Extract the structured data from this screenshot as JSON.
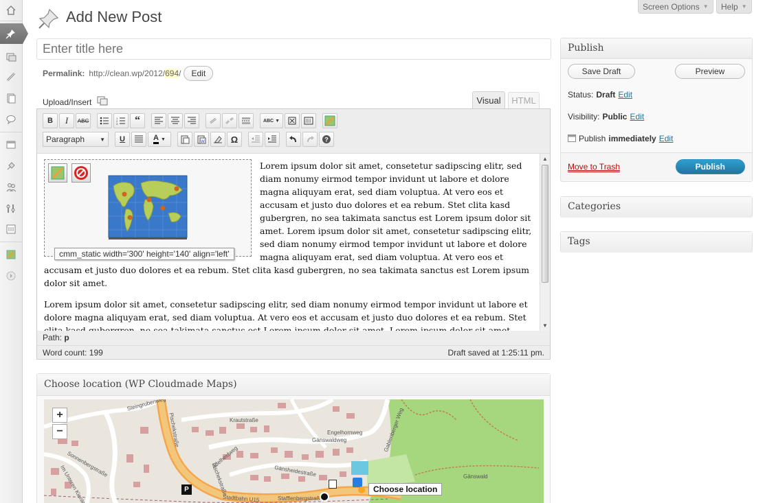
{
  "page": {
    "title": "Add New Post"
  },
  "top_tabs": {
    "screen_options": "Screen Options",
    "help": "Help"
  },
  "title_field": {
    "placeholder": "Enter title here",
    "value": ""
  },
  "permalink": {
    "label": "Permalink:",
    "base": "http://clean.wp/2012/",
    "slug": "694",
    "trail": "/",
    "edit_button": "Edit"
  },
  "editor": {
    "upload_insert": "Upload/Insert",
    "tabs": {
      "visual": "Visual",
      "html": "HTML"
    },
    "format_select": "Paragraph",
    "image_caption": "cmm_static width='300' height='140' align='left'",
    "paragraphs": [
      "Lorem ipsum dolor sit amet, consetetur sadipscing elitr, sed diam nonumy eirmod tempor invidunt ut labore et dolore magna aliquyam erat, sed diam voluptua. At vero eos et accusam et justo duo dolores et ea rebum. Stet clita kasd gubergren, no sea takimata sanctus est Lorem ipsum dolor sit amet. Lorem ipsum dolor sit amet, consetetur sadipscing elitr, sed diam nonumy eirmod tempor invidunt ut labore et dolore magna aliquyam erat, sed diam voluptua. At vero eos et accusam et justo duo dolores et ea rebum. Stet clita kasd gubergren, no sea takimata sanctus est Lorem ipsum dolor sit amet.",
      "Lorem ipsum dolor sit amet, consetetur sadipscing elitr, sed diam nonumy eirmod tempor invidunt ut labore et dolore magna aliquyam erat, sed diam voluptua. At vero eos et accusam et justo duo dolores et ea rebum. Stet clita kasd gubergren, no sea takimata sanctus est Lorem ipsum dolor sit amet. Lorem ipsum dolor sit amet, consetetur"
    ],
    "path_label": "Path:",
    "path_value": "p",
    "word_count": "Word count: 199",
    "draft_saved": "Draft saved at 1:25:11 pm."
  },
  "map_box": {
    "title": "Choose location (WP Cloudmade Maps)",
    "zoom_in": "+",
    "zoom_out": "−",
    "tooltip": "Choose location",
    "streets": [
      "Steingrubenweg",
      "Pischekstraße",
      "Krautstraße",
      "Gänswaldweg",
      "Engelhornweg",
      "Gablenberger Weg",
      "Adelheidweg",
      "Gänsheidestraße",
      "Sonnenbergstraße",
      "Im Unteren Kienle",
      "Stadtbahn U15",
      "Gänswald",
      "Stafflenbergstraße",
      "Pischekstraße"
    ],
    "parking": "P"
  },
  "publish": {
    "title": "Publish",
    "save_draft": "Save Draft",
    "preview": "Preview",
    "status_label": "Status:",
    "status_value": "Draft",
    "visibility_label": "Visibility:",
    "visibility_value": "Public",
    "publish_label": "Publish",
    "publish_value": "immediately",
    "edit": "Edit",
    "trash": "Move to Trash",
    "publish_button": "Publish"
  },
  "categories": {
    "title": "Categories"
  },
  "tags": {
    "title": "Tags"
  },
  "colors": {
    "accent": "#21759b",
    "trash": "#bc0b0b",
    "highlight": "#fffbcc"
  }
}
